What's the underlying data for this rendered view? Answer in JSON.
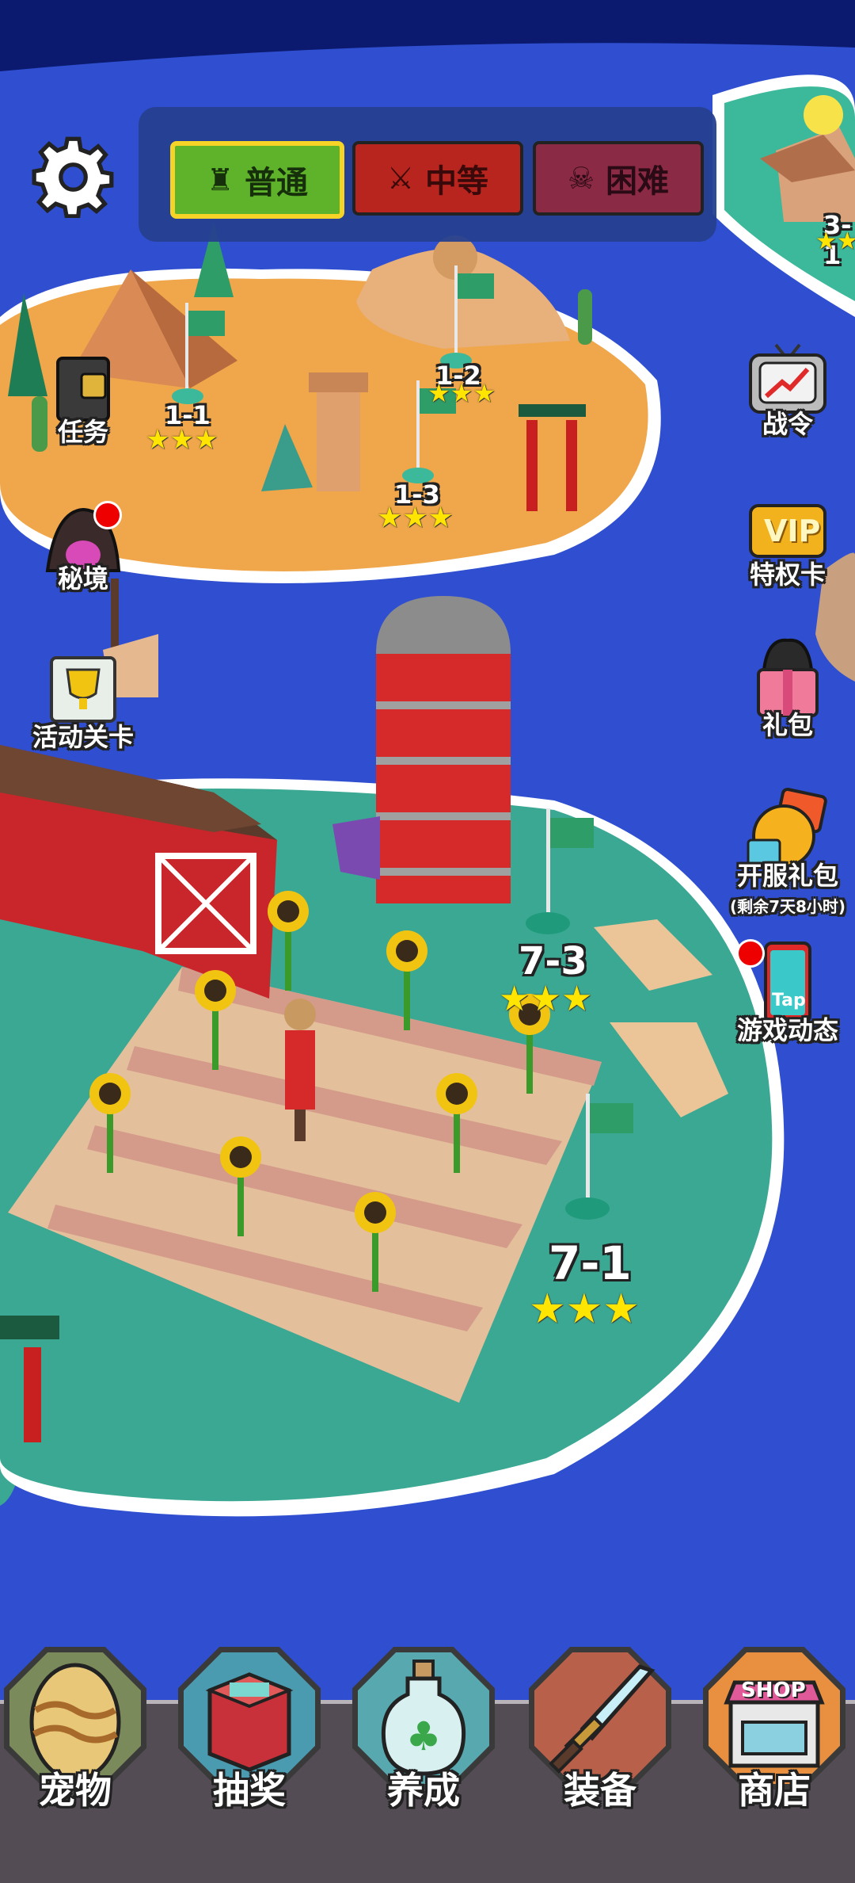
{
  "difficulty": {
    "normal": "普通",
    "medium": "中等",
    "hard": "困难",
    "selected": "普通"
  },
  "levels": {
    "l1_1": {
      "label": "1-1",
      "stars": "★★★"
    },
    "l1_2": {
      "label": "1-2",
      "stars": "★★★"
    },
    "l1_3": {
      "label": "1-3",
      "stars": "★★★"
    },
    "l3_1": {
      "label": "3-1",
      "stars": "★★"
    },
    "l7_3": {
      "label": "7-3",
      "stars": "★★★"
    },
    "l7_1": {
      "label": "7-1",
      "stars": "★★★"
    }
  },
  "left_menu": {
    "tasks": "任务",
    "secret": "秘境",
    "event": "活动关卡"
  },
  "right_menu": {
    "battle_pass": "战令",
    "privilege": "特权卡",
    "gift": "礼包",
    "server_gift": "开服礼包",
    "server_gift_timer": "(剩余7天8小时)",
    "news": "游戏动态"
  },
  "bottom_nav": {
    "pet": "宠物",
    "lottery": "抽奖",
    "nurture": "养成",
    "equip": "装备",
    "shop": "商店"
  },
  "icons": {
    "vip_text": "VIP",
    "shop_text": "SHOP",
    "tap_text": "Tap"
  },
  "colors": {
    "ocean": "#2f4fd0",
    "desert": "#f0a64a",
    "grass": "#3aa893",
    "normal_btn": "#5fb32a",
    "medium_btn": "#b8241e",
    "hard_btn": "#8a2a45",
    "star": "#ffe500"
  }
}
